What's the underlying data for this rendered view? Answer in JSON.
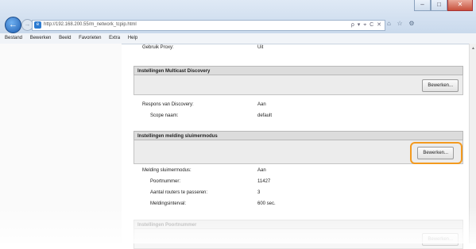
{
  "browser": {
    "url": "http://192.168.200.55/m_network_tcpip.html",
    "window_buttons": [
      "–",
      "□",
      "✕"
    ],
    "address_tools": "ρ ▾ ⌖ C ✕",
    "tab_icons": [
      "⌂",
      "☆",
      "⚙"
    ]
  },
  "menu": [
    "Bestand",
    "Bewerken",
    "Beeld",
    "Favorieten",
    "Extra",
    "Help"
  ],
  "proxy": {
    "label": "Gebruik Proxy:",
    "value": "Uit"
  },
  "multicast": {
    "title": "Instellingen Multicast Discovery",
    "edit_label": "Bewerken...",
    "rows": [
      {
        "label": "Respons van Discovery:",
        "value": "Aan"
      },
      {
        "label": "Scope naam:",
        "value": "default"
      }
    ]
  },
  "sleep": {
    "title": "Instellingen melding sluimermodus",
    "edit_label": "Bewerken...",
    "rows": [
      {
        "label": "Melding sluimermodus:",
        "value": "Aan"
      },
      {
        "label": "Poortnummer:",
        "value": "11427"
      },
      {
        "label": "Aantal routers te passeren:",
        "value": "3"
      },
      {
        "label": "Meldingsinterval:",
        "value": "600 sec."
      }
    ]
  },
  "port": {
    "title": "Instellingen Poortnummer",
    "edit_label": "Bewerken..."
  }
}
